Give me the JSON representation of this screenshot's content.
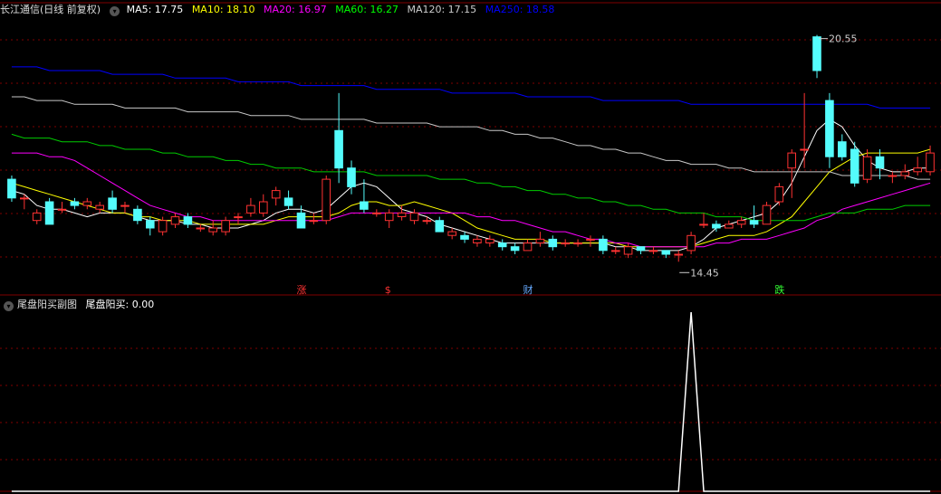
{
  "main_legend": {
    "title": "长江通信(日线 前复权)",
    "ma": [
      {
        "label": "MA5: 17.75",
        "color": "#ffffff"
      },
      {
        "label": "MA10: 18.10",
        "color": "#ffff00"
      },
      {
        "label": "MA20: 16.97",
        "color": "#ff00ff"
      },
      {
        "label": "MA60: 16.27",
        "color": "#00ff00"
      },
      {
        "label": "MA120: 17.15",
        "color": "#cccccc"
      },
      {
        "label": "MA250: 18.58",
        "color": "#0000ff"
      }
    ]
  },
  "sub_legend": {
    "title": "尾盘阳买副图",
    "value_label": "尾盘阳买: 0.00"
  },
  "annotations": {
    "high_label": "20.55",
    "low_label": "14.45",
    "markers": [
      {
        "text": "涨",
        "color": "#ff3333",
        "day": 23
      },
      {
        "text": "$",
        "color": "#ff3333",
        "day": 30
      },
      {
        "text": "财",
        "color": "#66aaff",
        "day": 41
      },
      {
        "text": "跌",
        "color": "#33ff33",
        "day": 61
      }
    ]
  },
  "chart_data": {
    "type": "candlestick",
    "price_range": [
      14.0,
      21.0
    ],
    "up_color": "#ff3232",
    "down_color": "#54fcfc",
    "candles": [
      [
        16.7,
        16.2,
        16.8,
        16.1
      ],
      [
        16.2,
        16.2,
        16.3,
        15.9
      ],
      [
        15.6,
        15.8,
        15.9,
        15.5
      ],
      [
        16.1,
        15.5,
        16.2,
        15.5
      ],
      [
        15.9,
        15.9,
        16.1,
        15.8
      ],
      [
        16.1,
        16.0,
        16.2,
        15.9
      ],
      [
        16.0,
        16.1,
        16.2,
        15.9
      ],
      [
        15.9,
        16.0,
        16.1,
        15.8
      ],
      [
        16.2,
        15.9,
        16.4,
        15.8
      ],
      [
        16.0,
        16.0,
        16.1,
        15.8
      ],
      [
        15.9,
        15.6,
        16.0,
        15.5
      ],
      [
        15.6,
        15.4,
        15.7,
        15.2
      ],
      [
        15.3,
        15.6,
        15.7,
        15.2
      ],
      [
        15.5,
        15.7,
        15.8,
        15.4
      ],
      [
        15.7,
        15.5,
        15.8,
        15.4
      ],
      [
        15.4,
        15.4,
        15.5,
        15.3
      ],
      [
        15.3,
        15.4,
        15.6,
        15.2
      ],
      [
        15.3,
        15.6,
        15.7,
        15.2
      ],
      [
        15.7,
        15.7,
        15.8,
        15.5
      ],
      [
        15.8,
        16.0,
        16.2,
        15.7
      ],
      [
        15.8,
        16.1,
        16.3,
        15.7
      ],
      [
        16.2,
        16.4,
        16.5,
        16.0
      ],
      [
        16.2,
        16.0,
        16.4,
        15.9
      ],
      [
        15.8,
        15.4,
        16.0,
        15.4
      ],
      [
        15.6,
        15.6,
        15.8,
        15.5
      ],
      [
        15.6,
        16.7,
        16.8,
        15.5
      ],
      [
        18.0,
        17.0,
        19.0,
        16.6
      ],
      [
        17.0,
        16.5,
        17.2,
        16.3
      ],
      [
        16.1,
        15.9,
        16.7,
        15.8
      ],
      [
        15.8,
        15.8,
        15.9,
        15.7
      ],
      [
        15.6,
        15.8,
        15.9,
        15.4
      ],
      [
        15.7,
        15.8,
        16.0,
        15.6
      ],
      [
        15.6,
        15.8,
        15.9,
        15.5
      ],
      [
        15.6,
        15.6,
        15.7,
        15.5
      ],
      [
        15.6,
        15.3,
        15.7,
        15.3
      ],
      [
        15.2,
        15.3,
        15.4,
        15.1
      ],
      [
        15.2,
        15.1,
        15.3,
        15.0
      ],
      [
        15.0,
        15.1,
        15.2,
        14.9
      ],
      [
        15.0,
        15.1,
        15.2,
        14.9
      ],
      [
        15.0,
        14.9,
        15.1,
        14.8
      ],
      [
        14.9,
        14.8,
        15.0,
        14.7
      ],
      [
        14.8,
        15.0,
        15.1,
        14.8
      ],
      [
        15.0,
        15.1,
        15.3,
        14.9
      ],
      [
        15.1,
        14.9,
        15.2,
        14.8
      ],
      [
        15.0,
        15.0,
        15.1,
        14.9
      ],
      [
        15.0,
        15.0,
        15.1,
        14.9
      ],
      [
        15.1,
        15.1,
        15.2,
        14.9
      ],
      [
        15.1,
        14.8,
        15.2,
        14.7
      ],
      [
        14.8,
        14.8,
        14.9,
        14.7
      ],
      [
        14.7,
        14.9,
        15.0,
        14.6
      ],
      [
        14.9,
        14.8,
        14.9,
        14.7
      ],
      [
        14.8,
        14.8,
        14.9,
        14.7
      ],
      [
        14.8,
        14.7,
        14.8,
        14.6
      ],
      [
        14.7,
        14.7,
        14.8,
        14.5
      ],
      [
        14.8,
        15.2,
        15.3,
        14.7
      ],
      [
        15.5,
        15.5,
        15.8,
        15.4
      ],
      [
        15.5,
        15.4,
        15.6,
        15.3
      ],
      [
        15.4,
        15.5,
        15.6,
        15.4
      ],
      [
        15.5,
        15.6,
        15.7,
        15.4
      ],
      [
        15.6,
        15.5,
        16.0,
        15.4
      ],
      [
        15.5,
        16.0,
        16.1,
        15.5
      ],
      [
        16.1,
        16.5,
        16.6,
        16.0
      ],
      [
        17.0,
        17.4,
        17.5,
        16.2
      ],
      [
        17.5,
        17.5,
        19.0,
        17.0
      ],
      [
        20.5,
        19.6,
        20.55,
        19.4
      ],
      [
        18.8,
        17.3,
        19.0,
        17.0
      ],
      [
        17.7,
        17.3,
        17.9,
        17.2
      ],
      [
        17.5,
        16.6,
        17.7,
        16.5
      ],
      [
        16.7,
        17.3,
        17.5,
        16.6
      ],
      [
        17.3,
        17.0,
        17.5,
        16.7
      ],
      [
        16.8,
        16.8,
        16.9,
        16.6
      ],
      [
        16.8,
        16.9,
        17.1,
        16.7
      ],
      [
        16.9,
        17.0,
        17.3,
        16.8
      ],
      [
        16.9,
        17.4,
        17.6,
        16.8
      ]
    ],
    "ma_series": [
      {
        "name": "MA5",
        "color": "#ffffff",
        "values": [
          16.4,
          16.3,
          16.0,
          15.9,
          15.9,
          15.8,
          15.7,
          15.8,
          15.8,
          15.8,
          15.7,
          15.6,
          15.6,
          15.6,
          15.5,
          15.5,
          15.4,
          15.4,
          15.4,
          15.5,
          15.6,
          15.8,
          15.9,
          15.9,
          15.8,
          15.9,
          16.2,
          16.5,
          16.6,
          16.5,
          16.2,
          15.9,
          15.8,
          15.7,
          15.5,
          15.4,
          15.3,
          15.2,
          15.1,
          15.0,
          15.0,
          15.0,
          15.0,
          15.0,
          15.0,
          15.0,
          15.0,
          15.0,
          14.9,
          14.9,
          14.8,
          14.8,
          14.8,
          14.8,
          14.9,
          15.1,
          15.4,
          15.5,
          15.6,
          15.7,
          15.8,
          16.1,
          16.6,
          17.3,
          18.0,
          18.3,
          18.1,
          17.6,
          17.2,
          17.0,
          16.9,
          16.9,
          17.0,
          17.0
        ]
      },
      {
        "name": "MA10",
        "color": "#ffff00",
        "values": [
          16.6,
          16.5,
          16.4,
          16.3,
          16.2,
          16.1,
          16.0,
          15.9,
          15.8,
          15.8,
          15.7,
          15.7,
          15.6,
          15.6,
          15.6,
          15.5,
          15.5,
          15.5,
          15.5,
          15.5,
          15.5,
          15.6,
          15.7,
          15.7,
          15.7,
          15.7,
          15.8,
          16.0,
          16.1,
          16.1,
          16.0,
          16.0,
          16.1,
          16.0,
          15.9,
          15.8,
          15.6,
          15.4,
          15.3,
          15.2,
          15.1,
          15.1,
          15.1,
          15.0,
          15.0,
          15.0,
          15.0,
          15.0,
          15.0,
          14.9,
          14.9,
          14.9,
          14.9,
          14.9,
          14.9,
          15.0,
          15.1,
          15.2,
          15.2,
          15.2,
          15.3,
          15.5,
          15.7,
          16.1,
          16.5,
          16.9,
          17.1,
          17.3,
          17.4,
          17.4,
          17.4,
          17.4,
          17.4,
          17.5
        ]
      },
      {
        "name": "MA20",
        "color": "#ff00ff",
        "values": [
          17.4,
          17.4,
          17.4,
          17.3,
          17.3,
          17.2,
          17.0,
          16.8,
          16.6,
          16.4,
          16.2,
          16.0,
          15.9,
          15.8,
          15.7,
          15.7,
          15.6,
          15.6,
          15.6,
          15.6,
          15.6,
          15.6,
          15.6,
          15.6,
          15.6,
          15.6,
          15.7,
          15.8,
          15.8,
          15.8,
          15.8,
          15.8,
          15.8,
          15.8,
          15.8,
          15.8,
          15.8,
          15.7,
          15.7,
          15.6,
          15.6,
          15.5,
          15.4,
          15.3,
          15.3,
          15.2,
          15.1,
          15.1,
          15.0,
          15.0,
          14.9,
          14.9,
          14.9,
          14.9,
          14.9,
          14.9,
          15.0,
          15.0,
          15.1,
          15.1,
          15.1,
          15.2,
          15.3,
          15.4,
          15.6,
          15.7,
          15.9,
          16.0,
          16.1,
          16.2,
          16.3,
          16.4,
          16.5,
          16.6
        ]
      },
      {
        "name": "MA60",
        "color": "#00cc00",
        "values": [
          17.9,
          17.8,
          17.8,
          17.8,
          17.7,
          17.7,
          17.7,
          17.6,
          17.6,
          17.5,
          17.5,
          17.5,
          17.4,
          17.4,
          17.3,
          17.3,
          17.3,
          17.2,
          17.2,
          17.1,
          17.1,
          17.0,
          17.0,
          17.0,
          16.9,
          16.9,
          16.9,
          16.9,
          16.9,
          16.8,
          16.8,
          16.8,
          16.8,
          16.8,
          16.7,
          16.7,
          16.7,
          16.6,
          16.6,
          16.5,
          16.5,
          16.4,
          16.4,
          16.3,
          16.3,
          16.2,
          16.2,
          16.1,
          16.1,
          16.0,
          16.0,
          15.9,
          15.9,
          15.8,
          15.8,
          15.8,
          15.7,
          15.7,
          15.7,
          15.6,
          15.6,
          15.6,
          15.6,
          15.6,
          15.7,
          15.8,
          15.8,
          15.8,
          15.9,
          15.9,
          15.9,
          16.0,
          16.0,
          16.0
        ]
      },
      {
        "name": "MA120",
        "color": "#c8c8c8",
        "values": [
          18.9,
          18.9,
          18.8,
          18.8,
          18.8,
          18.7,
          18.7,
          18.7,
          18.7,
          18.6,
          18.6,
          18.6,
          18.6,
          18.6,
          18.5,
          18.5,
          18.5,
          18.5,
          18.5,
          18.4,
          18.4,
          18.4,
          18.4,
          18.3,
          18.3,
          18.3,
          18.3,
          18.3,
          18.3,
          18.2,
          18.2,
          18.2,
          18.2,
          18.2,
          18.1,
          18.1,
          18.1,
          18.1,
          18.0,
          18.0,
          17.9,
          17.9,
          17.8,
          17.8,
          17.7,
          17.6,
          17.6,
          17.5,
          17.5,
          17.4,
          17.4,
          17.3,
          17.2,
          17.2,
          17.1,
          17.1,
          17.1,
          17.0,
          17.0,
          16.9,
          16.9,
          16.9,
          16.9,
          16.9,
          16.9,
          16.9,
          16.8,
          16.8,
          16.8,
          16.8,
          16.8,
          16.8,
          16.7,
          16.7
        ]
      },
      {
        "name": "MA250",
        "color": "#0000ff",
        "values": [
          19.7,
          19.7,
          19.7,
          19.6,
          19.6,
          19.6,
          19.6,
          19.6,
          19.5,
          19.5,
          19.5,
          19.5,
          19.5,
          19.4,
          19.4,
          19.4,
          19.4,
          19.4,
          19.3,
          19.3,
          19.3,
          19.3,
          19.3,
          19.2,
          19.2,
          19.2,
          19.2,
          19.2,
          19.2,
          19.1,
          19.1,
          19.1,
          19.1,
          19.1,
          19.1,
          19.0,
          19.0,
          19.0,
          19.0,
          19.0,
          19.0,
          18.9,
          18.9,
          18.9,
          18.9,
          18.9,
          18.9,
          18.8,
          18.8,
          18.8,
          18.8,
          18.8,
          18.8,
          18.8,
          18.7,
          18.7,
          18.7,
          18.7,
          18.7,
          18.7,
          18.7,
          18.7,
          18.7,
          18.7,
          18.7,
          18.7,
          18.7,
          18.7,
          18.7,
          18.6,
          18.6,
          18.6,
          18.6,
          18.6
        ]
      }
    ],
    "indicator": {
      "name": "尾盘阳买",
      "color": "#ffffff",
      "range": [
        0,
        1
      ],
      "values": [
        0,
        0,
        0,
        0,
        0,
        0,
        0,
        0,
        0,
        0,
        0,
        0,
        0,
        0,
        0,
        0,
        0,
        0,
        0,
        0,
        0,
        0,
        0,
        0,
        0,
        0,
        0,
        0,
        0,
        0,
        0,
        0,
        0,
        0,
        0,
        0,
        0,
        0,
        0,
        0,
        0,
        0,
        0,
        0,
        0,
        0,
        0,
        0,
        0,
        0,
        0,
        0,
        0,
        0,
        1,
        0,
        0,
        0,
        0,
        0,
        0,
        0,
        0,
        0,
        0,
        0,
        0,
        0,
        0,
        0,
        0,
        0,
        0,
        0
      ]
    }
  }
}
